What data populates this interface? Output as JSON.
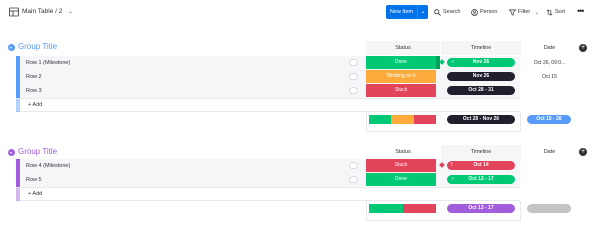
{
  "toolbar": {
    "board_view_label": "Main Table / 2",
    "new_item_label": "New Item",
    "search_label": "Search",
    "person_label": "Person",
    "filter_label": "Filter",
    "sort_label": "Sort"
  },
  "columns": {
    "status": "Status",
    "timeline": "Timeline",
    "date": "Date"
  },
  "groups": [
    {
      "title": "Group Title",
      "color": "#579bfc",
      "rows": [
        {
          "name": "Row 1 (Milestone)",
          "status": "Done",
          "status_color": "#00c875",
          "timeline": "Nov 26",
          "timeline_color": "#00c875",
          "date": "Oct 26, 09:0..."
        },
        {
          "name": "Row 2",
          "status": "Working on it",
          "status_color": "#fdab3d",
          "timeline": "Nov 26",
          "timeline_color": "#1f1f2e",
          "date": "Oct 15"
        },
        {
          "name": "Row 3",
          "status": "Stuck",
          "status_color": "#e2445c",
          "timeline": "Oct 28 - 31",
          "timeline_color": "#1f1f2e",
          "date": ""
        }
      ],
      "add_label": "+ Add",
      "summary_timeline": "Oct 28 - Nov 26",
      "summary_date": "Oct 15 - 26"
    },
    {
      "title": "Group Title",
      "color": "#a25ddc",
      "rows": [
        {
          "name": "Row 4 (Milestone)",
          "status": "Stuck",
          "status_color": "#e2445c",
          "timeline": "Oct 14",
          "timeline_color": "#e2445c",
          "date": ""
        },
        {
          "name": "Row 5",
          "status": "Done",
          "status_color": "#00c875",
          "timeline": "Oct 13 - 17",
          "timeline_color": "#00c875",
          "date": ""
        }
      ],
      "add_label": "+ Add",
      "summary_timeline": "Oct 13 - 17",
      "summary_date": "-"
    }
  ]
}
